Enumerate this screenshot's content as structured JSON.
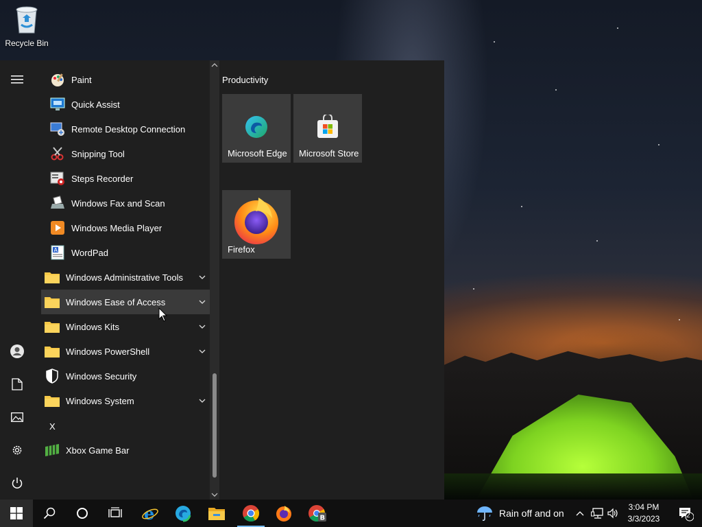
{
  "desktop": {
    "recycle_bin_label": "Recycle Bin"
  },
  "start_menu": {
    "apps": [
      {
        "label": "Paint",
        "icon": "paint-icon"
      },
      {
        "label": "Quick Assist",
        "icon": "quick-assist-icon"
      },
      {
        "label": "Remote Desktop Connection",
        "icon": "remote-desktop-icon"
      },
      {
        "label": "Snipping Tool",
        "icon": "snipping-tool-icon"
      },
      {
        "label": "Steps Recorder",
        "icon": "steps-recorder-icon"
      },
      {
        "label": "Windows Fax and Scan",
        "icon": "fax-scan-icon"
      },
      {
        "label": "Windows Media Player",
        "icon": "media-player-icon"
      },
      {
        "label": "WordPad",
        "icon": "wordpad-icon"
      }
    ],
    "folders": [
      {
        "label": "Windows Administrative Tools"
      },
      {
        "label": "Windows Ease of Access"
      },
      {
        "label": "Windows Kits"
      },
      {
        "label": "Windows PowerShell"
      }
    ],
    "windows_security_label": "Windows Security",
    "windows_system_label": "Windows System",
    "section_letter": "X",
    "xbox_label": "Xbox Game Bar",
    "tile_group_title": "Productivity",
    "tiles": {
      "edge": "Microsoft Edge",
      "store": "Microsoft Store",
      "firefox": "Firefox"
    }
  },
  "taskbar": {
    "weather_text": "Rain off and on",
    "time": "3:04 PM",
    "date": "3/3/2023",
    "notification_count": "2"
  },
  "colors": {
    "accent": "#76b9ed",
    "menu_bg": "#1f1f1f",
    "tile_bg": "#3b3b3b",
    "folder": "#f7c948"
  }
}
